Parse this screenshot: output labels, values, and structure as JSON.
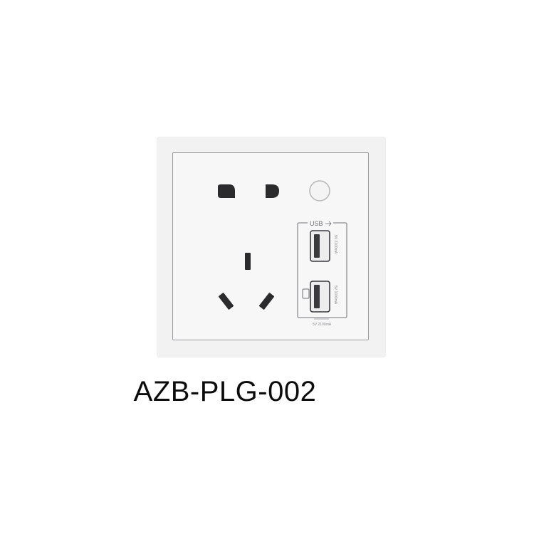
{
  "product": {
    "model": "AZB-PLG-002",
    "usb_label": "USB",
    "usb_port_1_rating": "5V 2100mA",
    "usb_port_2_rating": "5V 1000mA",
    "usb_total_rating": "5V 2100mA",
    "indicator_icon": "phone-icon"
  },
  "colors": {
    "plate": "#f2f2f3",
    "panel": "#f7f7f8",
    "border": "#9a9a9e",
    "socket_hole": "#2b2b2d",
    "usb_port": "#3a3a3e"
  }
}
